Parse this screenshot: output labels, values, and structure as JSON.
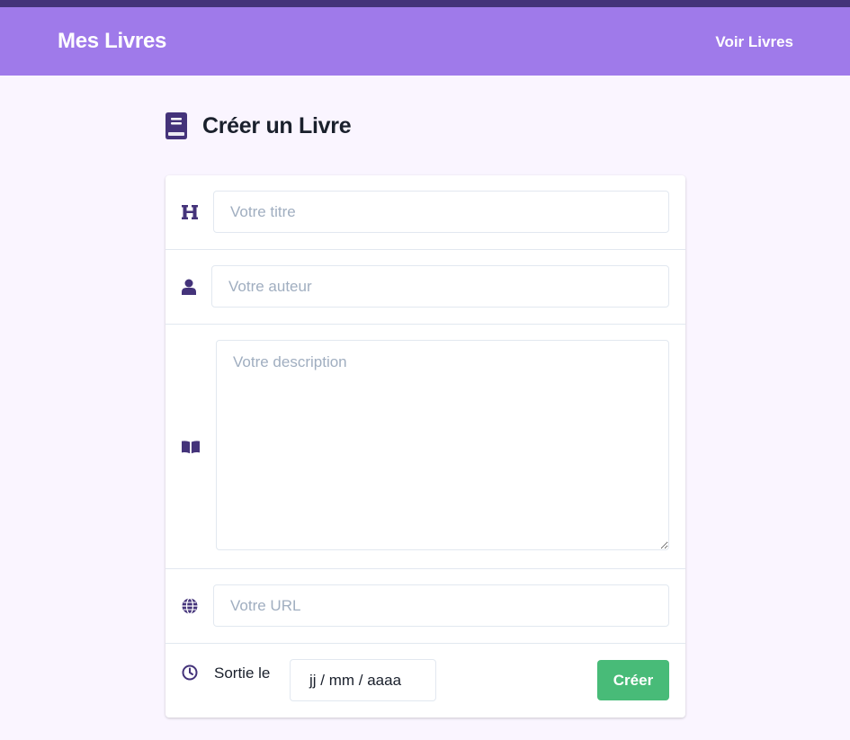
{
  "navbar": {
    "brand": "Mes Livres",
    "link": "Voir Livres",
    "color": "#9f7aea",
    "top_strip_color": "#44337a"
  },
  "page": {
    "title": "Créer un Livre",
    "title_icon": "book-icon"
  },
  "form": {
    "title_field": {
      "icon": "heading-icon",
      "placeholder": "Votre titre",
      "value": ""
    },
    "author_field": {
      "icon": "user-icon",
      "placeholder": "Votre auteur",
      "value": ""
    },
    "description_field": {
      "icon": "open-book-icon",
      "placeholder": "Votre description",
      "value": ""
    },
    "url_field": {
      "icon": "globe-icon",
      "placeholder": "Votre URL",
      "value": ""
    },
    "release": {
      "icon": "clock-icon",
      "label": "Sortie le",
      "date_placeholder": "jj / mm / aaaa"
    },
    "submit_label": "Créer",
    "submit_color": "#48bb78"
  },
  "icon_color": "#44337a"
}
